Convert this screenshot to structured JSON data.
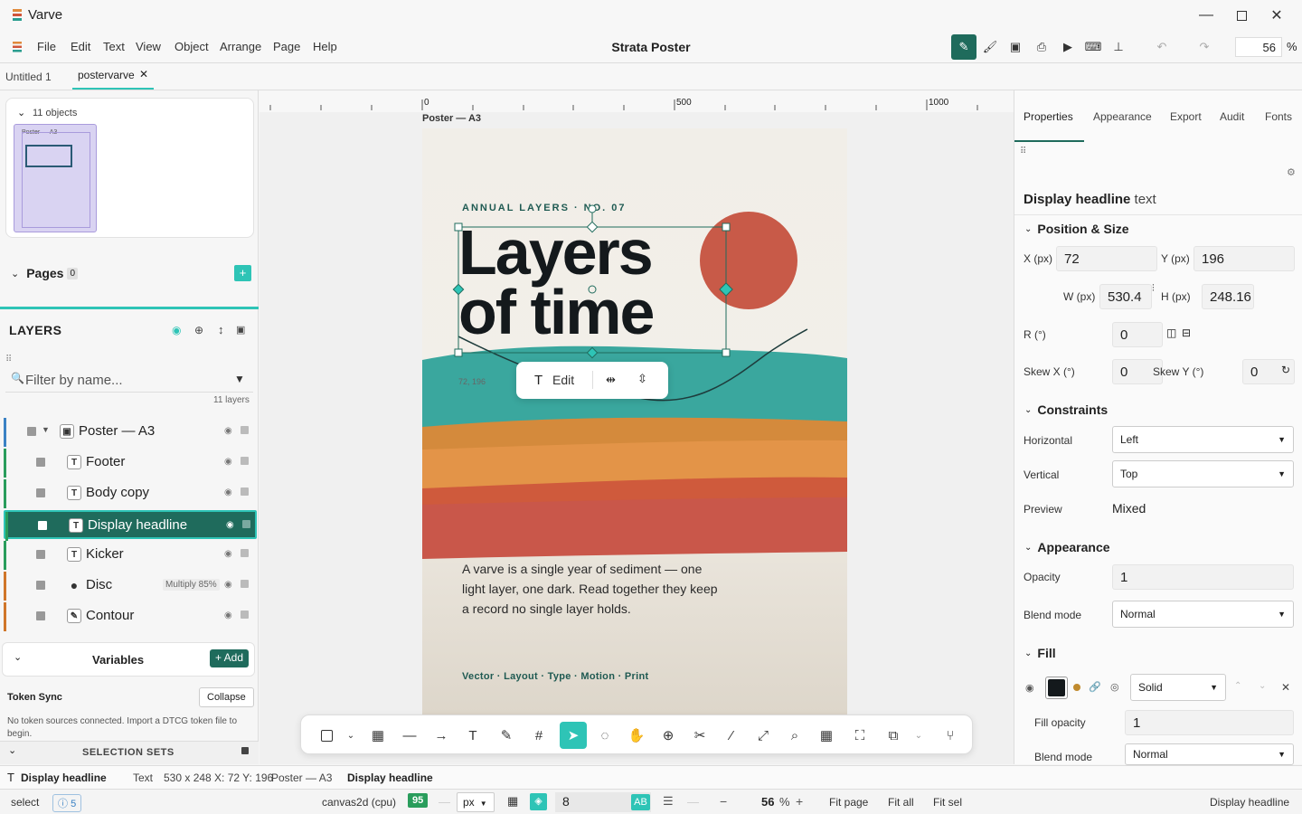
{
  "app": {
    "title": "Varve",
    "document_title": "Strata Poster"
  },
  "menu": [
    "File",
    "Edit",
    "Text",
    "View",
    "Object",
    "Arrange",
    "Page",
    "Help"
  ],
  "toolbar": {
    "zoom_value": "56",
    "zoom_unit": "%"
  },
  "tabs": [
    {
      "label": "Untitled 1"
    },
    {
      "label": "postervarve"
    }
  ],
  "left": {
    "objects_count": "11 objects",
    "thumb_label": "Poster — A3",
    "pages_title": "Pages",
    "pages_count": "0",
    "pages_add": "+",
    "layers_title": "LAYERS",
    "filter_placeholder": "Filter by name...",
    "layers_count": "11 layers",
    "layers": [
      {
        "name": "Poster — A3",
        "icon": "artboard-icon",
        "bar": "#3b82c4"
      },
      {
        "name": "Footer",
        "icon": "text-icon",
        "bar": "#2a9d5c"
      },
      {
        "name": "Body copy",
        "icon": "text-icon",
        "bar": "#2a9d5c"
      },
      {
        "name": "Display headline",
        "icon": "text-icon",
        "bar": "#2a9d5c"
      },
      {
        "name": "Kicker",
        "icon": "text-icon",
        "bar": "#2a9d5c"
      },
      {
        "name": "Disc",
        "icon": "circle-icon",
        "bar": "#d0762a",
        "badge": "Multiply 85%"
      },
      {
        "name": "Contour",
        "icon": "pen-icon",
        "bar": "#d0762a"
      }
    ],
    "variables_title": "Variables",
    "variables_add": "+ Add",
    "token_sync_title": "Token Sync",
    "token_sync_collapse": "Collapse",
    "token_sync_text": "No token sources connected. Import a DTCG token file to begin.",
    "selection_sets": "SELECTION SETS"
  },
  "canvas": {
    "ruler_labels": [
      "0",
      "500",
      "1000"
    ],
    "artboard_label": "Poster — A3",
    "kicker": "ANNUAL LAYERS · NO. 07",
    "headline_1": "Layers",
    "headline_2": "of time",
    "coords": "72, 196",
    "edit_label": "Edit",
    "body": "A varve is a single year of sediment — one light layer, one dark. Read together they keep a record no single layer holds.",
    "footer": "Vector · Layout · Type · Motion · Print"
  },
  "right": {
    "tabs": [
      "Properties",
      "Appearance",
      "Export",
      "Audit",
      "Fonts"
    ],
    "object_name": "Display headline",
    "object_type": "text",
    "position_size": "Position & Size",
    "x_label": "X (px)",
    "x_value": "72",
    "y_label": "Y (px)",
    "y_value": "196",
    "w_label": "W (px)",
    "w_value": "530.4",
    "h_label": "H (px)",
    "h_value": "248.16",
    "r_label": "R (°)",
    "r_value": "0",
    "skewx_label": "Skew X (°)",
    "skewx_value": "0",
    "skewy_label": "Skew Y (°)",
    "skewy_value": "0",
    "constraints": "Constraints",
    "horizontal_label": "Horizontal",
    "horizontal_value": "Left",
    "vertical_label": "Vertical",
    "vertical_value": "Top",
    "preview_label": "Preview",
    "preview_value": "Mixed",
    "appearance": "Appearance",
    "opacity_label": "Opacity",
    "opacity_value": "1",
    "blend_label": "Blend mode",
    "blend_value": "Normal",
    "fill": "Fill",
    "fill_type": "Solid",
    "fill_opacity_label": "Fill opacity",
    "fill_opacity_value": "1",
    "fill_blend_label": "Blend mode",
    "fill_blend_value": "Normal"
  },
  "status": {
    "sel_name": "Display headline",
    "sel_type": "Text",
    "sel_dims": "530 x 248 X: 72 Y: 196",
    "crumb_parent": "Poster — A3",
    "crumb_current": "Display headline",
    "mode": "select",
    "issues": "5",
    "renderer": "canvas2d (cpu)",
    "fps": "95",
    "unit": "px",
    "snap_value": "8",
    "zoom": "56",
    "zoom_unit": "%",
    "fit_page": "Fit page",
    "fit_all": "Fit all",
    "fit_sel": "Fit sel",
    "right_label": "Display headline"
  },
  "colors": {
    "accent": "#1f6b5c",
    "teal": "#2ec4b6",
    "disc": "#c85a48"
  }
}
